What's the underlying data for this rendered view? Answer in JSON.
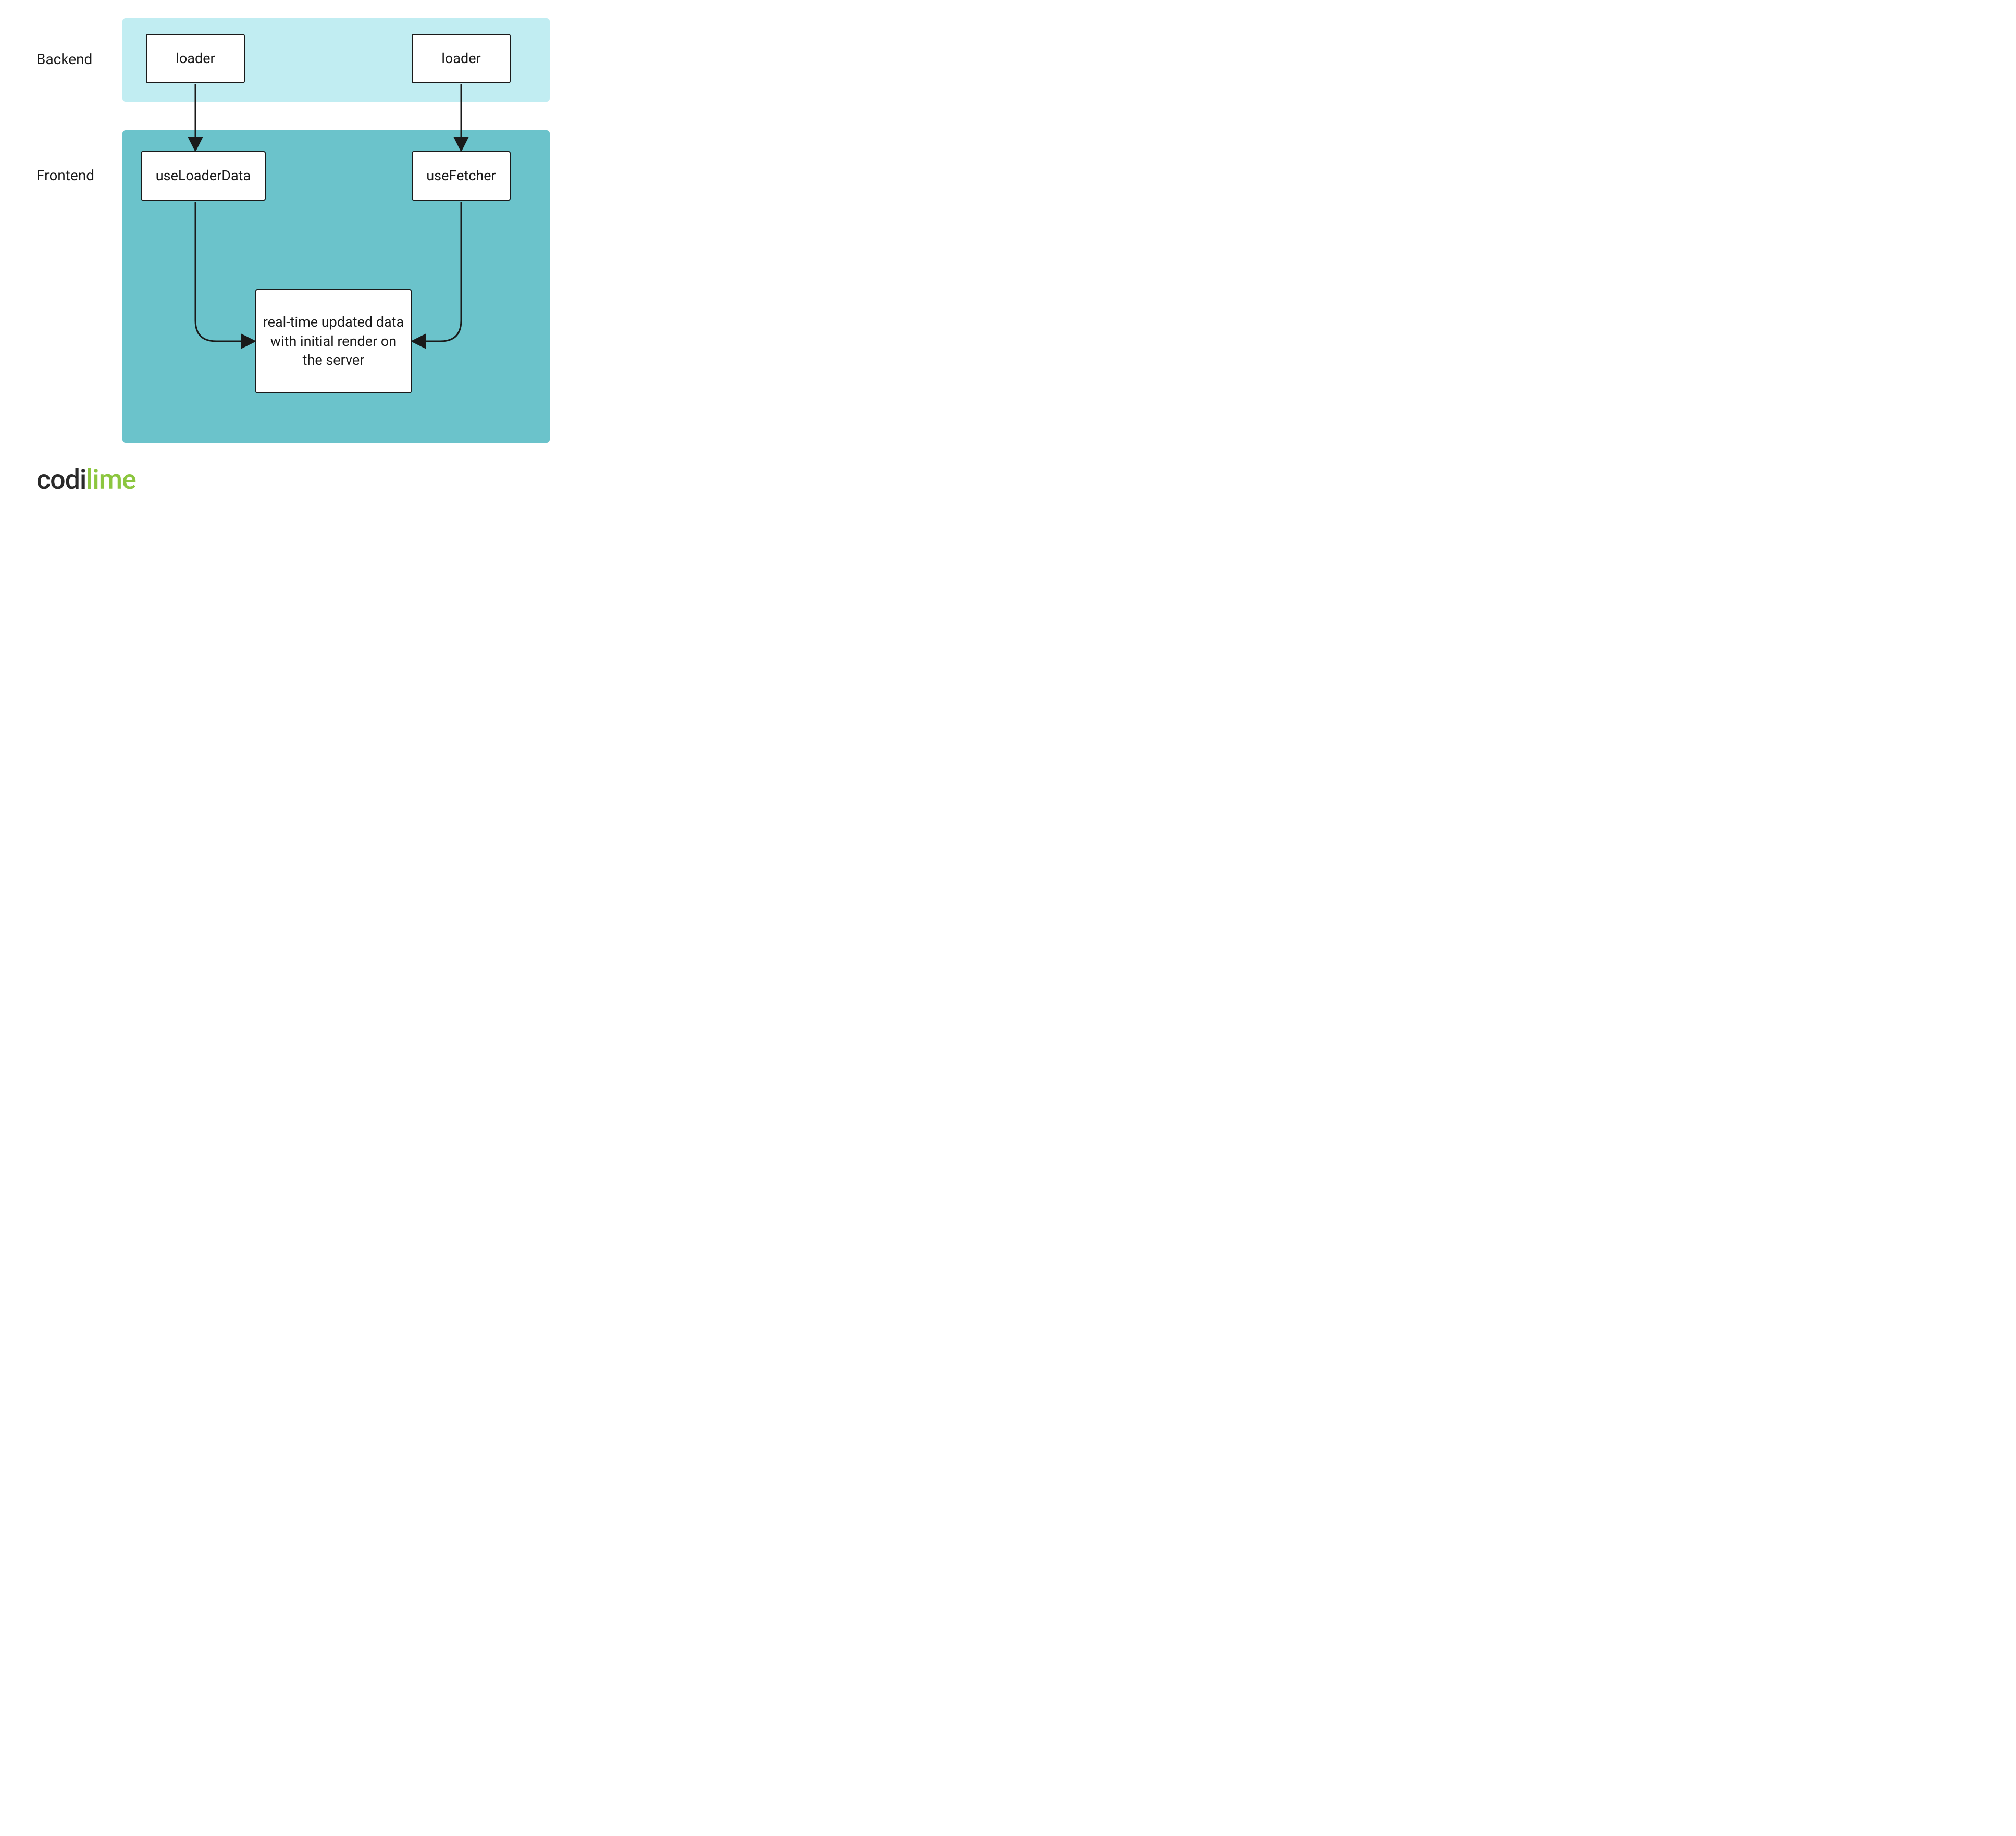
{
  "labels": {
    "backend": "Backend",
    "frontend": "Frontend"
  },
  "boxes": {
    "loader_left": "loader",
    "loader_right": "loader",
    "useLoaderData": "useLoaderData",
    "useFetcher": "useFetcher",
    "result": "real-time updated data with initial render on the server"
  },
  "colors": {
    "backend_bg": "#c1edf2",
    "frontend_bg": "#6bc3cb",
    "box_bg": "#ffffff",
    "border": "#1a1a1a",
    "text": "#1a1a1a",
    "logo_dark": "#2a2a2a",
    "logo_lime": "#8cc63f"
  },
  "logo": {
    "part1": "codi",
    "part2": "lime"
  },
  "diagram": {
    "type": "flowchart",
    "nodes": [
      {
        "id": "loader_left",
        "layer": "Backend",
        "label": "loader"
      },
      {
        "id": "loader_right",
        "layer": "Backend",
        "label": "loader"
      },
      {
        "id": "useLoaderData",
        "layer": "Frontend",
        "label": "useLoaderData"
      },
      {
        "id": "useFetcher",
        "layer": "Frontend",
        "label": "useFetcher"
      },
      {
        "id": "result",
        "layer": "Frontend",
        "label": "real-time updated data with initial render on the server"
      }
    ],
    "edges": [
      {
        "from": "loader_left",
        "to": "useLoaderData"
      },
      {
        "from": "loader_right",
        "to": "useFetcher"
      },
      {
        "from": "useLoaderData",
        "to": "result"
      },
      {
        "from": "useFetcher",
        "to": "result"
      }
    ]
  }
}
